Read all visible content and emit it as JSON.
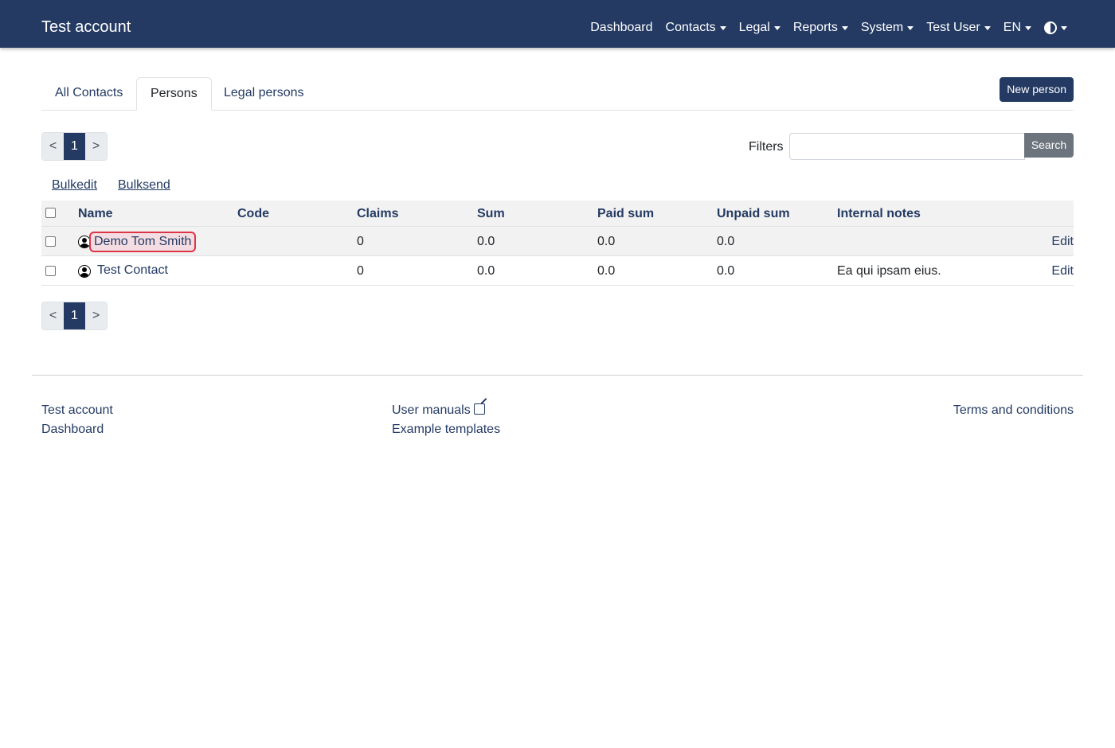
{
  "navbar": {
    "brand": "Test account",
    "items": [
      {
        "label": "Dashboard",
        "dropdown": false
      },
      {
        "label": "Contacts",
        "dropdown": true
      },
      {
        "label": "Legal",
        "dropdown": true
      },
      {
        "label": "Reports",
        "dropdown": true
      },
      {
        "label": "System",
        "dropdown": true
      },
      {
        "label": "Test User",
        "dropdown": true
      },
      {
        "label": "EN",
        "dropdown": true
      }
    ],
    "theme_icon": "contrast-icon"
  },
  "tabs": [
    {
      "label": "All Contacts",
      "active": false
    },
    {
      "label": "Persons",
      "active": true
    },
    {
      "label": "Legal persons",
      "active": false
    }
  ],
  "new_person_label": "New person",
  "pagination": {
    "prev": "<",
    "current": "1",
    "next": ">"
  },
  "filters": {
    "label": "Filters",
    "value": "",
    "search_label": "Search"
  },
  "bulk": {
    "edit": "Bulkedit",
    "send": "Bulksend"
  },
  "table": {
    "headers": [
      "Name",
      "Code",
      "Claims",
      "Sum",
      "Paid sum",
      "Unpaid sum",
      "Internal notes"
    ],
    "rows": [
      {
        "name": "Demo Tom Smith",
        "code": "",
        "claims": "0",
        "sum": "0.0",
        "paid_sum": "0.0",
        "unpaid_sum": "0.0",
        "notes": "",
        "edit": "Edit",
        "checked": false
      },
      {
        "name": "Test Contact",
        "code": "",
        "claims": "0",
        "sum": "0.0",
        "paid_sum": "0.0",
        "unpaid_sum": "0.0",
        "notes": "Ea qui ipsam eius.",
        "edit": "Edit",
        "checked": false
      }
    ]
  },
  "footer": {
    "col1": [
      "Test account",
      "Dashboard"
    ],
    "col2": [
      "User manuals",
      "Example templates"
    ],
    "col3": [
      "Terms and conditions"
    ]
  },
  "colors": {
    "primary": "#243a63",
    "highlight_border": "#dc3545",
    "secondary_button": "#6c757d"
  }
}
